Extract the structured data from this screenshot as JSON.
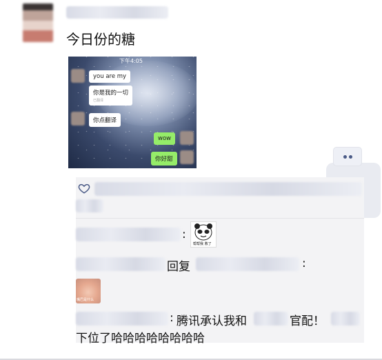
{
  "post": {
    "text": "今日份的糖"
  },
  "photo": {
    "time": "下午4:05",
    "messages": [
      {
        "text": "you are my",
        "side": "left"
      },
      {
        "text": "你是我的一切",
        "sub": "已翻译",
        "side": "left"
      },
      {
        "text": "你点翻译",
        "side": "left"
      },
      {
        "text": "wow",
        "side": "right"
      },
      {
        "text": "你好甜",
        "side": "right"
      }
    ]
  },
  "comments": {
    "reply_word": "回复",
    "colon": ":",
    "third_text": "腾讯承认我和",
    "third_text_2": "官配！",
    "third_line2": "下位了哈哈哈哈哈哈哈哈",
    "panda_caption": "帮帮我 救了",
    "baby_caption": "嘴巴是什么"
  },
  "colors": {
    "comment_bg": "#f3f3f5",
    "heart": "#4a5a86",
    "wechat_green": "#95ec69"
  }
}
